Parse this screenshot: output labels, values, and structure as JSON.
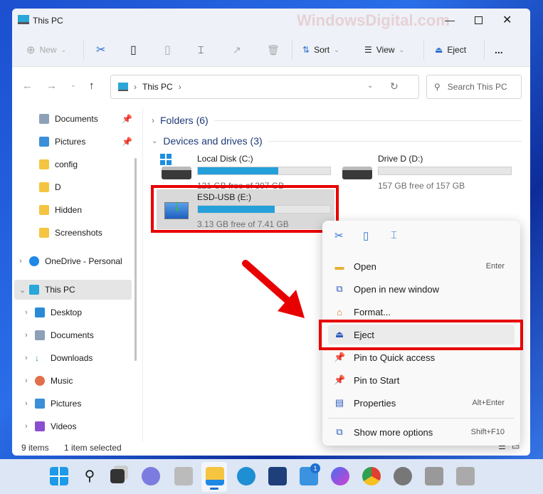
{
  "window": {
    "title": "This PC"
  },
  "watermark": "WindowsDigital.com",
  "toolbar": {
    "new": "New",
    "sort": "Sort",
    "view": "View",
    "eject": "Eject",
    "more": "..."
  },
  "address": {
    "path": "This PC",
    "search_placeholder": "Search This PC"
  },
  "sidebar": {
    "quick": [
      {
        "label": "Documents",
        "pinned": true
      },
      {
        "label": "Pictures",
        "pinned": true
      },
      {
        "label": "config"
      },
      {
        "label": "D"
      },
      {
        "label": "Hidden"
      },
      {
        "label": "Screenshots"
      }
    ],
    "onedrive": "OneDrive - Personal",
    "thispc": "This PC",
    "pc_items": [
      "Desktop",
      "Documents",
      "Downloads",
      "Music",
      "Pictures",
      "Videos"
    ]
  },
  "content": {
    "folders": "Folders (6)",
    "devices": "Devices and drives (3)",
    "drives": [
      {
        "name": "Local Disk (C:)",
        "free": "121 GB free of 307 GB",
        "used_pct": 61
      },
      {
        "name": "Drive D (D:)",
        "free": "157 GB free of 157 GB",
        "used_pct": 0
      },
      {
        "name": "ESD-USB (E:)",
        "free": "3.13 GB free of 7.41 GB",
        "used_pct": 58
      }
    ]
  },
  "context_menu": {
    "items": [
      {
        "label": "Open",
        "shortcut": "Enter"
      },
      {
        "label": "Open in new window",
        "shortcut": ""
      },
      {
        "label": "Format...",
        "shortcut": ""
      },
      {
        "label": "Eject",
        "shortcut": ""
      },
      {
        "label": "Pin to Quick access",
        "shortcut": ""
      },
      {
        "label": "Pin to Start",
        "shortcut": ""
      },
      {
        "label": "Properties",
        "shortcut": "Alt+Enter"
      },
      {
        "label": "Show more options",
        "shortcut": "Shift+F10"
      }
    ]
  },
  "status": {
    "items": "9 items",
    "selected": "1 item selected"
  },
  "taskbar": {
    "mail_badge": "1"
  },
  "colors": {
    "accent": "#26a0da",
    "highlight": "#e80000"
  }
}
